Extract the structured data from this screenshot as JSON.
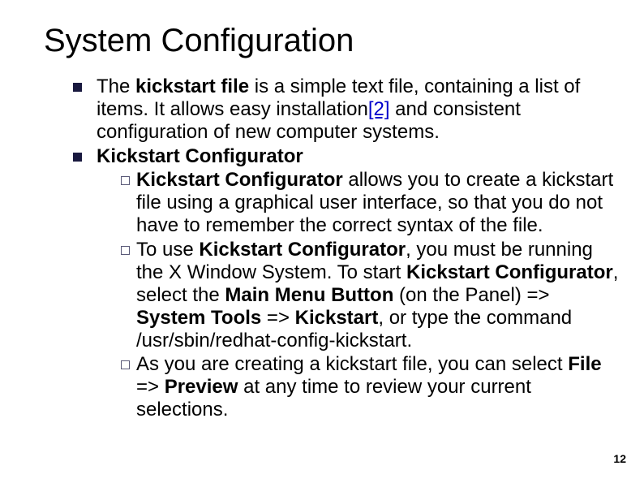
{
  "title": "System Configuration",
  "bullet1": {
    "pre": "The ",
    "bold1": "kickstart file",
    "mid1": " is a simple text file, containing a list of items. It allows easy installation",
    "link": "[2]",
    "post": " and consistent configuration of new computer systems."
  },
  "bullet2_header": "Kickstart Configurator",
  "sub1": {
    "bold1": "Kickstart Configurator",
    "rest": " allows you to create a kickstart file using a graphical user interface, so that you do not have to remember the correct syntax of the file."
  },
  "sub2": {
    "p1": "To use ",
    "b1": "Kickstart Configurator",
    "p2": ", you must be running the X Window System. To start ",
    "b2": "Kickstart Configurator",
    "p3": ", select the ",
    "b3": "Main Menu Button",
    "p4": " (on the Panel) => ",
    "b4": "System Tools",
    "p5": " => ",
    "b5": "Kickstart",
    "p6": ", or type the command /usr/sbin/redhat-config-kickstart."
  },
  "sub3": {
    "p1": "As you are creating a kickstart file, you can select ",
    "b1": "File",
    "p2": " => ",
    "b2": "Preview",
    "p3": " at any time to review your current selections."
  },
  "page_number": "12"
}
